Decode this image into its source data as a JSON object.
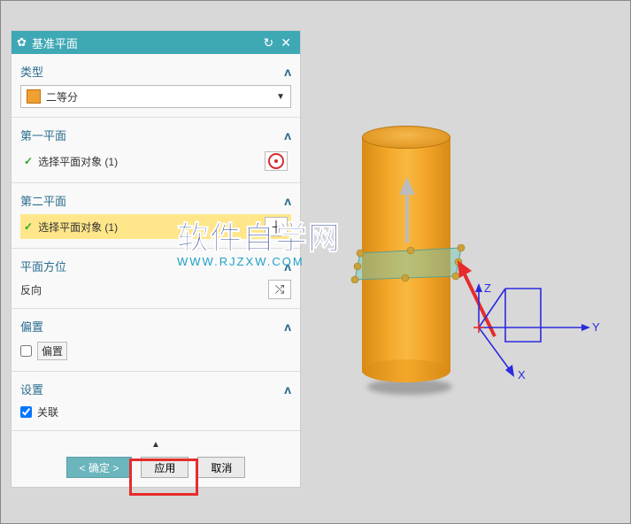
{
  "panel": {
    "title": "基准平面",
    "sections": {
      "type": {
        "label": "类型",
        "value": "二等分"
      },
      "plane1": {
        "label": "第一平面",
        "select_text": "选择平面对象 (1)"
      },
      "plane2": {
        "label": "第二平面",
        "select_text": "选择平面对象 (1)"
      },
      "orient": {
        "label": "平面方位",
        "value": "反向"
      },
      "offset": {
        "label": "偏置",
        "checkbox": "偏置"
      },
      "settings": {
        "label": "设置",
        "checkbox": "关联"
      }
    },
    "buttons": {
      "ok": "< 确定 >",
      "apply": "应用",
      "cancel": "取消"
    }
  },
  "viewport": {
    "axes": {
      "x": "X",
      "y": "Y",
      "z": "Z"
    }
  },
  "watermark": {
    "line1": "软件自学网",
    "line2": "WWW.RJZXW.COM"
  }
}
